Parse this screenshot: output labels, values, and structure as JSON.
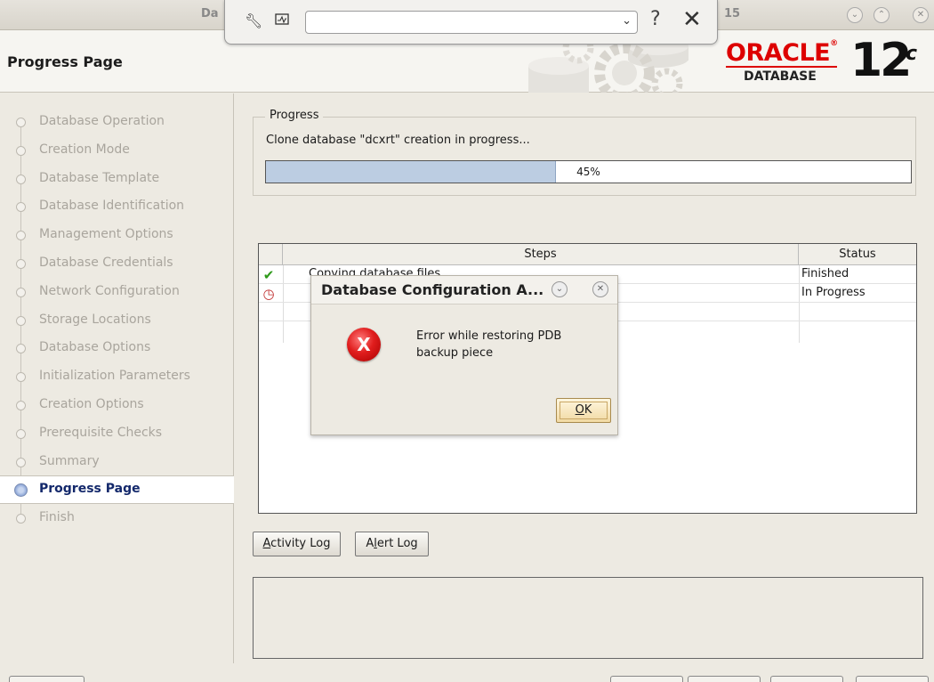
{
  "window": {
    "title_left": "Da",
    "title_right": "15"
  },
  "toolbar": {
    "wrench_icon": "wrench-icon",
    "monitor_icon": "monitor-icon",
    "combo_value": "",
    "combo_arrow": "⌄",
    "help_label": "?",
    "close_label": "✕"
  },
  "header": {
    "page_title": "Progress Page",
    "brand_name": "ORACLE",
    "brand_sub": "DATABASE",
    "brand_version": "12",
    "brand_suffix": "c"
  },
  "sidebar": {
    "items": [
      {
        "label": "Database Operation"
      },
      {
        "label": "Creation Mode"
      },
      {
        "label": "Database Template"
      },
      {
        "label": "Database Identification"
      },
      {
        "label": "Management Options"
      },
      {
        "label": "Database Credentials"
      },
      {
        "label": "Network Configuration"
      },
      {
        "label": "Storage Locations"
      },
      {
        "label": "Database Options"
      },
      {
        "label": "Initialization Parameters"
      },
      {
        "label": "Creation Options"
      },
      {
        "label": "Prerequisite Checks"
      },
      {
        "label": "Summary"
      },
      {
        "label": "Progress Page"
      },
      {
        "label": "Finish"
      }
    ],
    "active_index": 13
  },
  "progress": {
    "legend": "Progress",
    "message": "Clone database \"dcxrt\" creation in progress...",
    "percent_text": "45%",
    "percent_value": 45
  },
  "steps_table": {
    "columns": [
      "",
      "Steps",
      "Status"
    ],
    "rows": [
      {
        "icon": "check-icon",
        "step": "Copying database files",
        "status": "Finished"
      },
      {
        "icon": "clock-icon",
        "step": "",
        "status": "In Progress"
      },
      {
        "icon": "",
        "step": "",
        "status": ""
      }
    ]
  },
  "buttons": {
    "activity_log_prefix": "",
    "activity_log_mnemonic": "A",
    "activity_log_rest": "ctivity Log",
    "alert_log_prefix": "A",
    "alert_log_mnemonic": "l",
    "alert_log_rest": "ert Log"
  },
  "dialog": {
    "title": "Database Configuration A...",
    "message": "Error while restoring PDB backup piece",
    "icon_glyph": "X",
    "ok_mnemonic": "O",
    "ok_rest": "K"
  },
  "colors": {
    "oracle_red": "#d00000",
    "active_step": "#13286b",
    "progress_fill": "#bccde2",
    "error_red": "#e01d1d"
  }
}
